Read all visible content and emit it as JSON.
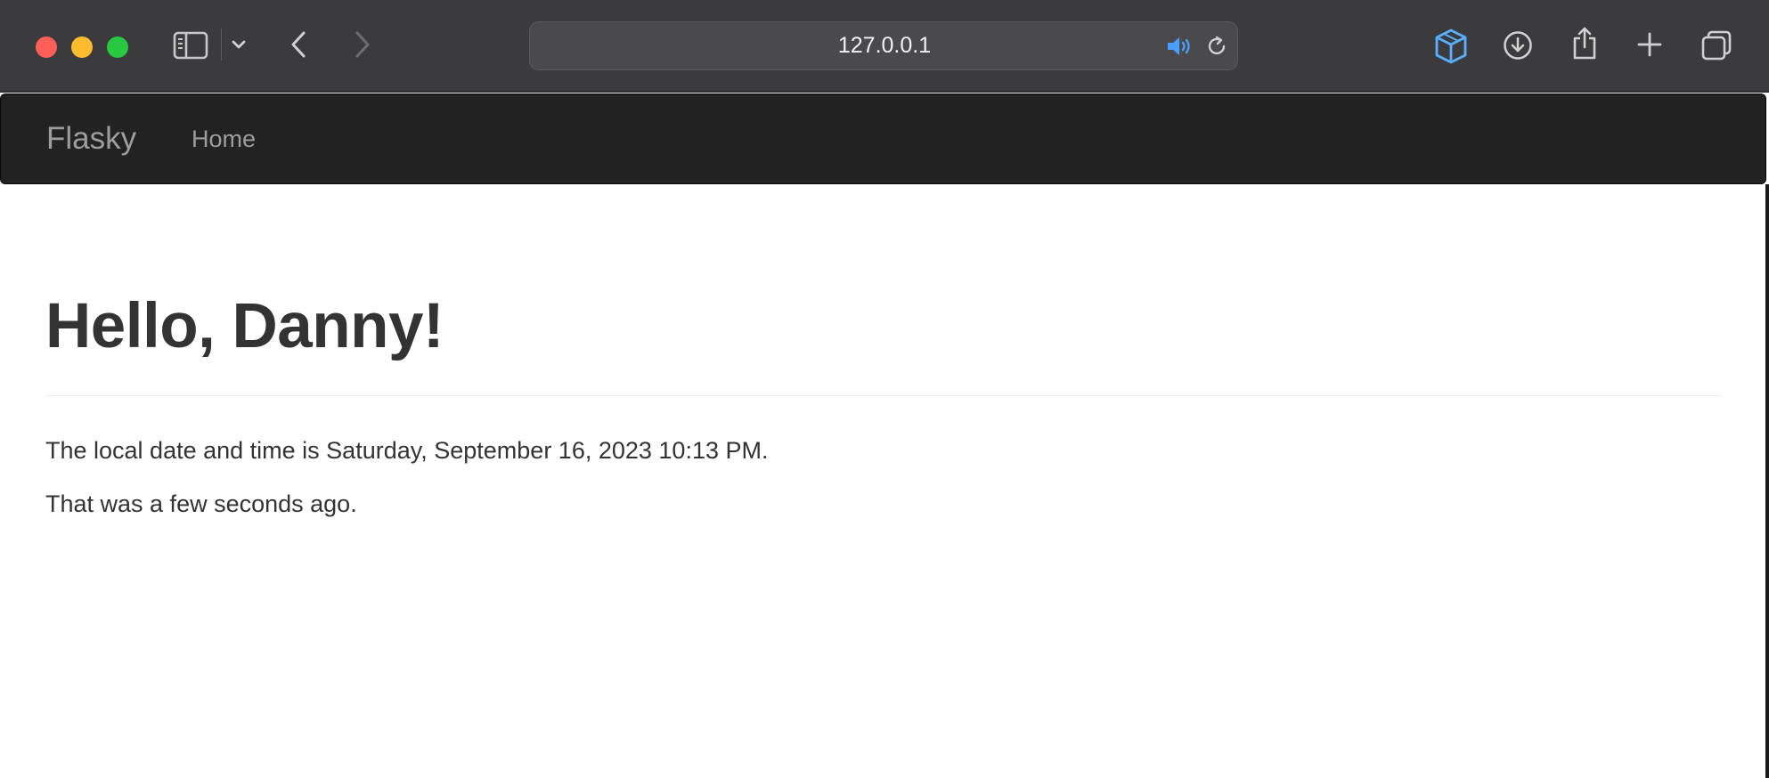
{
  "browser": {
    "address": "127.0.0.1",
    "icons": {
      "sidebar": "sidebar-icon",
      "sidebar_menu": "chevron-down-icon",
      "back": "chevron-left-icon",
      "forward": "chevron-right-icon",
      "audio": "speaker-icon",
      "reload": "reload-icon",
      "extension": "cube-icon",
      "downloads": "download-icon",
      "share": "share-icon",
      "new_tab": "plus-icon",
      "tabs": "tab-overview-icon"
    }
  },
  "navbar": {
    "brand": "Flasky",
    "links": [
      "Home"
    ]
  },
  "content": {
    "heading": "Hello, Danny!",
    "datetime_line": "The local date and time is Saturday, September 16, 2023 10:13 PM.",
    "relative_line": "That was a few seconds ago."
  },
  "colors": {
    "chrome": "#3b3b3d",
    "navbar": "#222222",
    "nav_text": "#9d9d9d",
    "body_text": "#333333",
    "accent": "#4a9eff"
  }
}
